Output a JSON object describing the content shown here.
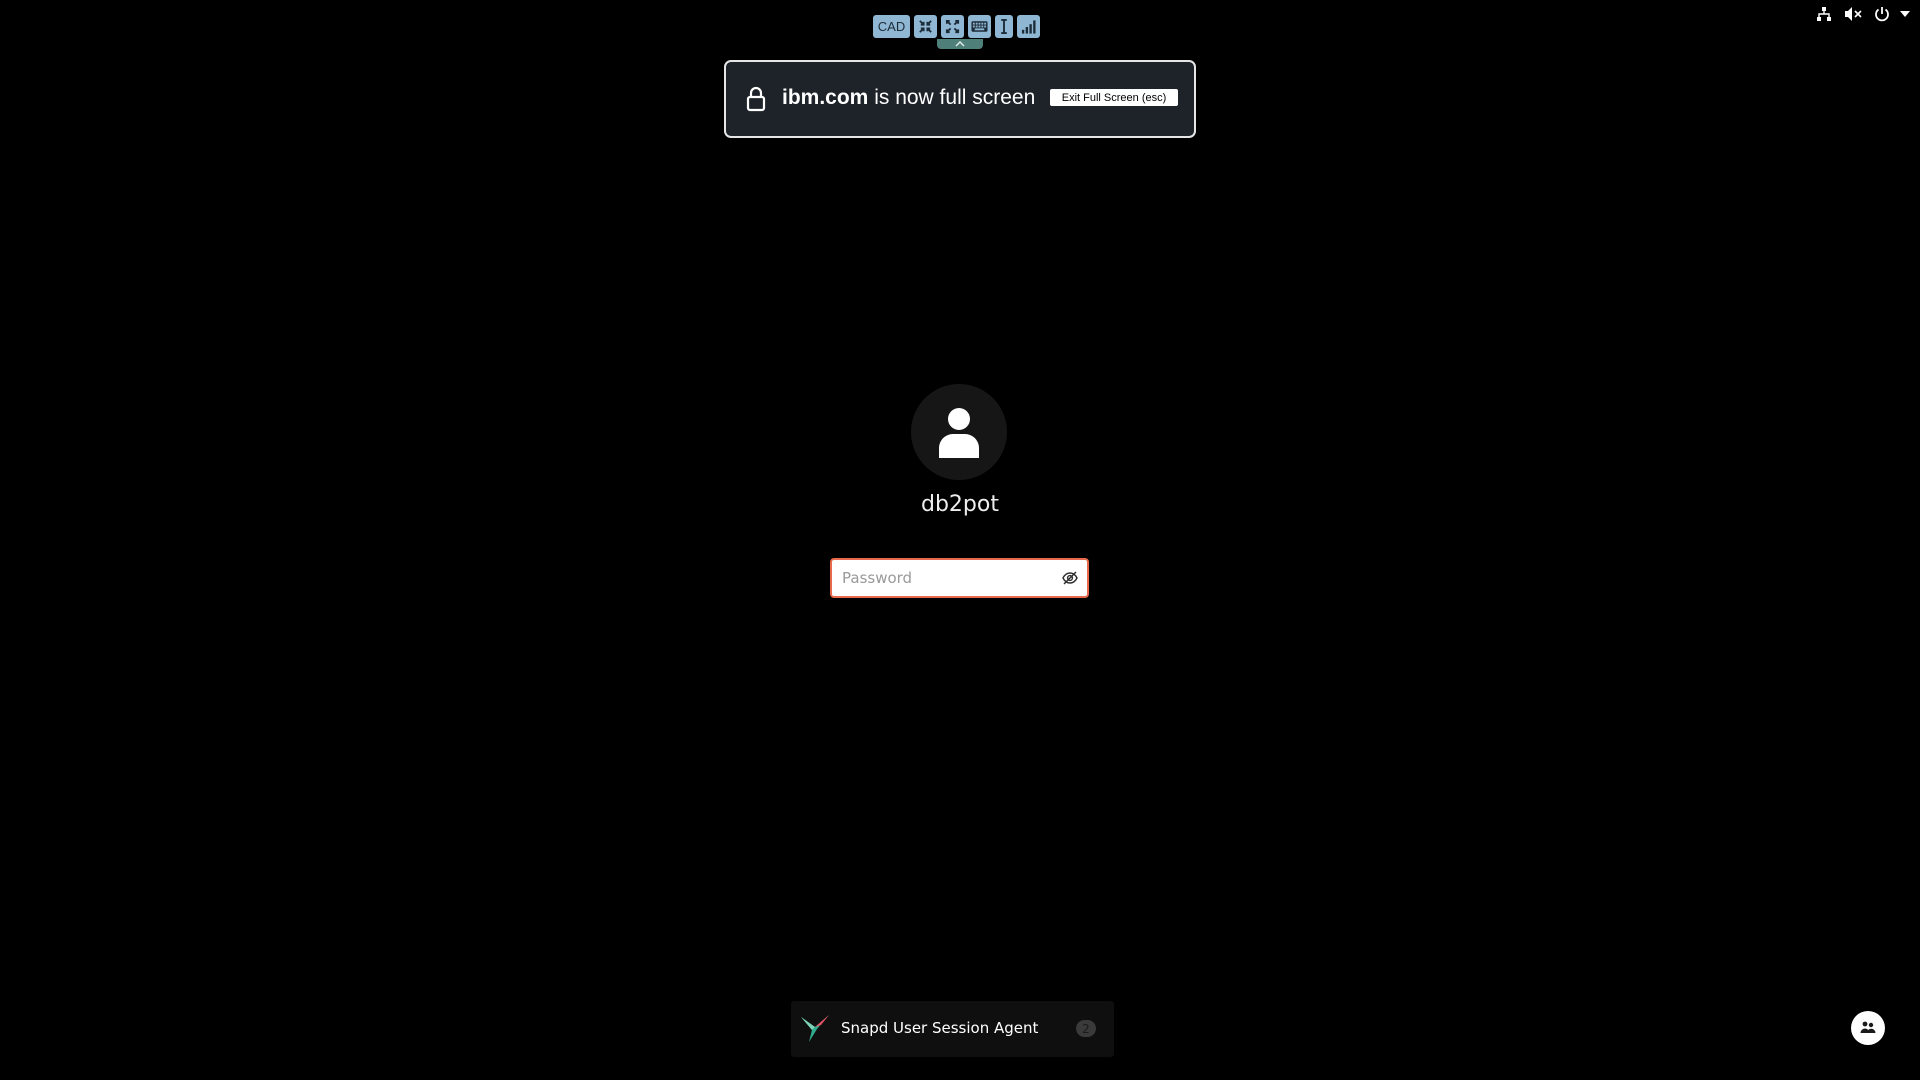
{
  "vnc_toolbar": {
    "cad_label": "CAD",
    "buttons": [
      "compress-icon",
      "expand-icon",
      "keyboard-icon",
      "text-cursor-icon",
      "signal-bars-icon"
    ],
    "collapse_icon": "chevron-up-icon",
    "button_color": "#8fb6d3"
  },
  "fullscreen_notice": {
    "domain": "ibm.com",
    "message": " is now full screen",
    "exit_label": "Exit Full Screen (esc)",
    "icon": "lock-icon"
  },
  "tray": {
    "icons": [
      "network-icon",
      "volume-muted-icon",
      "power-icon",
      "caret-down-icon"
    ]
  },
  "login": {
    "avatar_icon": "user-icon",
    "username": "db2pot",
    "password_placeholder": "Password",
    "password_value": "",
    "reveal_icon": "eye-slash-icon",
    "focus_color": "#e8694b"
  },
  "notification": {
    "icon": "snapd-bird-icon",
    "title": "Snapd User Session Agent",
    "count": "2"
  },
  "accessibility": {
    "icon": "accessibility-icon"
  }
}
